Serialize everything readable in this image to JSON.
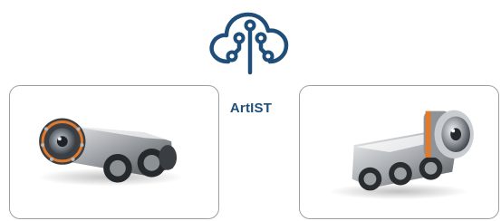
{
  "brand": {
    "name": "ArtIST",
    "logo_icon": "cloud-circuit-icon",
    "color": "#1f4e79"
  },
  "products": [
    {
      "icon": "crawler-robot-front-camera-image",
      "accent": "#e07a2e"
    },
    {
      "icon": "crawler-robot-side-camera-image",
      "accent": "#e07a2e"
    }
  ]
}
